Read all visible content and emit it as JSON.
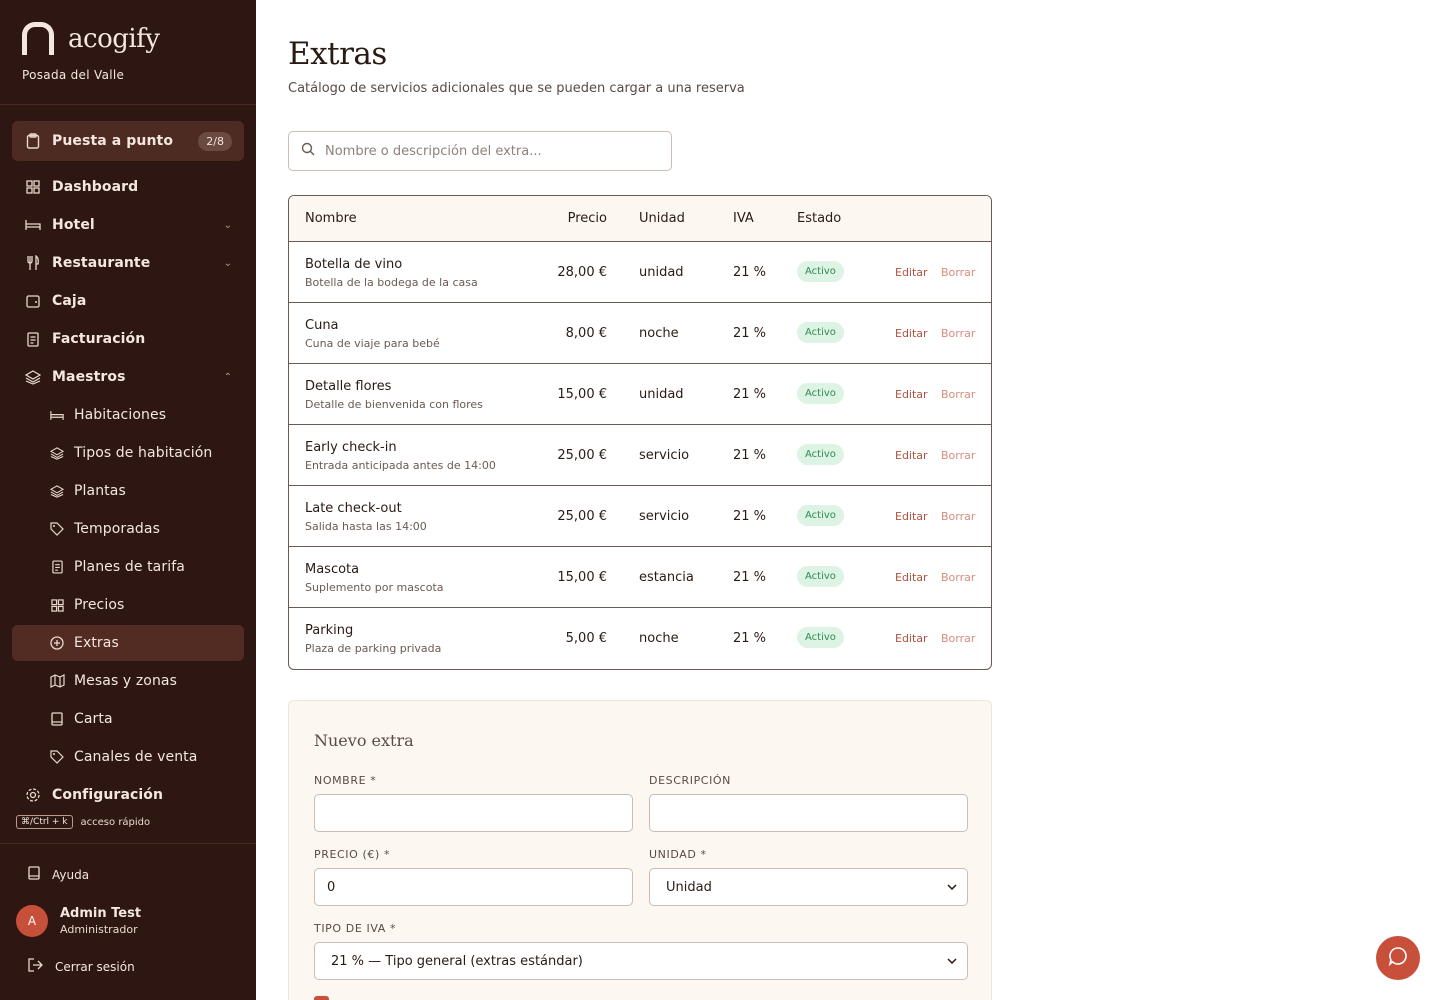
{
  "brand": {
    "name": "acogify",
    "hotel": "Posada del Valle"
  },
  "sidebar": {
    "setup": {
      "label": "Puesta a punto",
      "count": "2/8"
    },
    "items": [
      {
        "label": "Dashboard",
        "icon": "grid-icon"
      },
      {
        "label": "Hotel",
        "icon": "bed-icon"
      },
      {
        "label": "Restaurante",
        "icon": "utensils-icon"
      },
      {
        "label": "Caja",
        "icon": "wallet-icon"
      },
      {
        "label": "Facturación",
        "icon": "receipt-icon"
      },
      {
        "label": "Maestros",
        "icon": "layers-icon"
      }
    ],
    "sub_items": [
      {
        "label": "Habitaciones",
        "icon": "bed-icon"
      },
      {
        "label": "Tipos de habitación",
        "icon": "layers-icon"
      },
      {
        "label": "Plantas",
        "icon": "layers-icon"
      },
      {
        "label": "Temporadas",
        "icon": "tag-icon"
      },
      {
        "label": "Planes de tarifa",
        "icon": "receipt-icon"
      },
      {
        "label": "Precios",
        "icon": "grid-icon"
      },
      {
        "label": "Extras",
        "icon": "plus-circle-icon"
      },
      {
        "label": "Mesas y zonas",
        "icon": "map-icon"
      },
      {
        "label": "Carta",
        "icon": "book-icon"
      },
      {
        "label": "Canales de venta",
        "icon": "tag-icon"
      }
    ],
    "config": {
      "label": "Configuración"
    },
    "shortcut": {
      "key": "⌘/Ctrl + k",
      "label": "acceso rápido"
    },
    "help": "Ayuda",
    "user": {
      "initial": "A",
      "name": "Admin Test",
      "role": "Administrador"
    },
    "logout": "Cerrar sesión"
  },
  "page": {
    "title": "Extras",
    "subtitle": "Catálogo de servicios adicionales que se pueden cargar a una reserva"
  },
  "search": {
    "placeholder": "Nombre o descripción del extra..."
  },
  "table": {
    "headers": {
      "name": "Nombre",
      "price": "Precio",
      "unit": "Unidad",
      "iva": "IVA",
      "state": "Estado"
    },
    "actions": {
      "edit": "Editar",
      "delete": "Borrar"
    },
    "rows": [
      {
        "name": "Botella de vino",
        "desc": "Botella de la bodega de la casa",
        "price": "28,00 €",
        "unit": "unidad",
        "iva": "21 %",
        "state": "Activo"
      },
      {
        "name": "Cuna",
        "desc": "Cuna de viaje para bebé",
        "price": "8,00 €",
        "unit": "noche",
        "iva": "21 %",
        "state": "Activo"
      },
      {
        "name": "Detalle flores",
        "desc": "Detalle de bienvenida con flores",
        "price": "15,00 €",
        "unit": "unidad",
        "iva": "21 %",
        "state": "Activo"
      },
      {
        "name": "Early check-in",
        "desc": "Entrada anticipada antes de 14:00",
        "price": "25,00 €",
        "unit": "servicio",
        "iva": "21 %",
        "state": "Activo"
      },
      {
        "name": "Late check-out",
        "desc": "Salida hasta las 14:00",
        "price": "25,00 €",
        "unit": "servicio",
        "iva": "21 %",
        "state": "Activo"
      },
      {
        "name": "Mascota",
        "desc": "Suplemento por mascota",
        "price": "15,00 €",
        "unit": "estancia",
        "iva": "21 %",
        "state": "Activo"
      },
      {
        "name": "Parking",
        "desc": "Plaza de parking privada",
        "price": "5,00 €",
        "unit": "noche",
        "iva": "21 %",
        "state": "Activo"
      }
    ]
  },
  "form": {
    "title": "Nuevo extra",
    "name_label": "NOMBRE *",
    "name_value": "",
    "desc_label": "DESCRIPCIÓN",
    "desc_value": "",
    "price_label": "PRECIO (€) *",
    "price_value": "0",
    "unit_label": "UNIDAD *",
    "unit_value": "Unidad",
    "iva_label": "TIPO DE IVA *",
    "iva_value": "21 % — Tipo general (extras estándar)"
  },
  "colors": {
    "sidebar": "#2e1712",
    "accent": "#c8503a",
    "active_badge": "#ddf3e4"
  }
}
